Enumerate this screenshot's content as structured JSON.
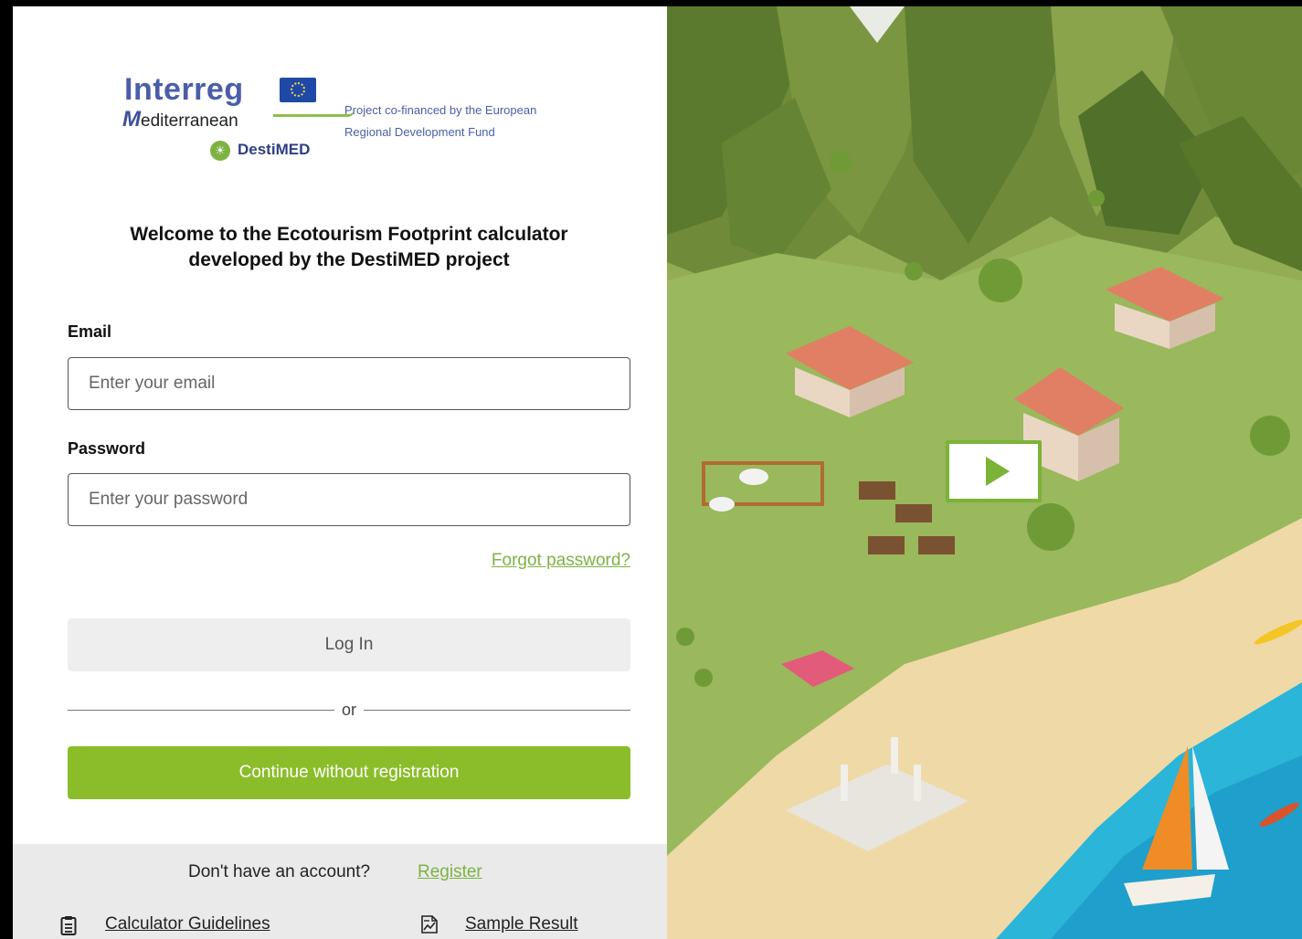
{
  "logo": {
    "brand": "Interreg",
    "region_initial": "M",
    "region_rest": "editerranean",
    "project": "DestiMED",
    "cofinanced_line1": "Project co-financed by the European",
    "cofinanced_line2": "Regional Development Fund"
  },
  "welcome": {
    "line1": "Welcome to the Ecotourism Footprint calculator",
    "line2": "developed by the DestiMED project"
  },
  "form": {
    "email_label": "Email",
    "email_placeholder": "Enter your email",
    "password_label": "Password",
    "password_placeholder": "Enter your password",
    "forgot_label": "Forgot password?",
    "login_label": "Log In",
    "or_label": "or",
    "continue_label": "Continue without registration"
  },
  "footer": {
    "no_account_text": "Don't have an account?",
    "register_label": "Register",
    "guidelines_label": "Calculator Guidelines",
    "sample_label": "Sample Result"
  },
  "colors": {
    "accent": "#8bbd2a",
    "link": "#7cb342",
    "brand_blue": "#4a5ea8"
  }
}
